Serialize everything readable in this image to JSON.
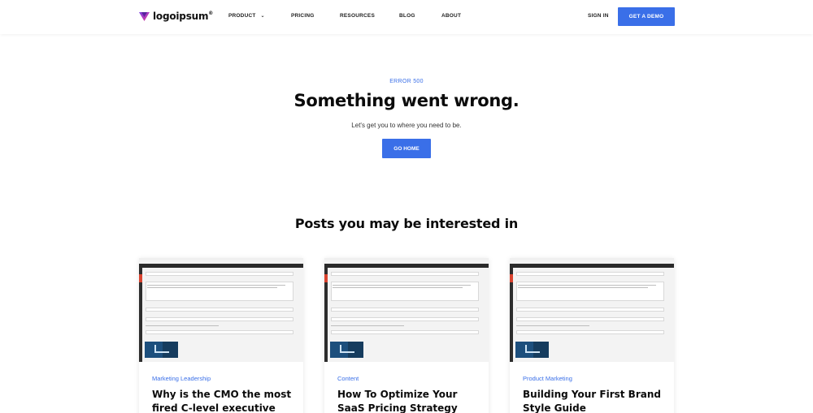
{
  "header": {
    "logo_text": "logoipsum",
    "logo_tm": "®",
    "nav": [
      {
        "label": "PRODUCT",
        "has_caret": true
      },
      {
        "label": "PRICING"
      },
      {
        "label": "RESOURCES"
      },
      {
        "label": "BLOG"
      },
      {
        "label": "ABOUT"
      }
    ],
    "sign_in": "SIGN IN",
    "cta": "GET A DEMO",
    "caret_icon": "chevron-down-icon"
  },
  "hero": {
    "eyebrow": "ERROR 500",
    "title": "Something went wrong.",
    "subtitle": "Let's get you to where you need to be.",
    "button": "GO HOME"
  },
  "posts": {
    "title": "Posts you may be interested in",
    "items": [
      {
        "category": "Marketing Leadership",
        "title": "Why is the CMO the most fired C-level executive"
      },
      {
        "category": "Content",
        "title": "How To Optimize Your SaaS Pricing Strategy"
      },
      {
        "category": "Product Marketing",
        "title": "Building Your First Brand Style Guide"
      }
    ]
  },
  "colors": {
    "accent": "#3a6fe8",
    "logo_gradient_start": "#7b3fe4",
    "logo_gradient_end": "#e33d96"
  }
}
